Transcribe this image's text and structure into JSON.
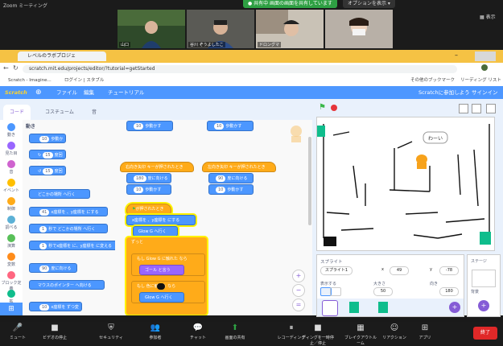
{
  "zoom": {
    "title": "Zoom ミーティング",
    "share_banner": "● 共有中  画面の画面を共有しています",
    "options_button": "オプションを表示 ▾",
    "view_label": "表示",
    "participants": [
      {
        "name": "山口"
      },
      {
        "name": "谷川 ぞうよしたこ"
      },
      {
        "name": "ドロングマ"
      },
      {
        "name": ""
      }
    ],
    "toolbar": [
      {
        "label": "ミュート",
        "icon": "microphone-icon",
        "glyph": "🎤"
      },
      {
        "label": "ビデオの停止",
        "icon": "video-camera-icon",
        "glyph": "■"
      },
      {
        "label": "セキュリティ",
        "icon": "shield-icon",
        "glyph": "⛨"
      },
      {
        "label": "参加者",
        "icon": "participants-icon",
        "glyph": "👥"
      },
      {
        "label": "チャット",
        "icon": "chat-icon",
        "glyph": "💬"
      },
      {
        "label": "画面の共有",
        "icon": "share-screen-icon",
        "glyph": "⬆"
      },
      {
        "label": "レコーディング",
        "icon": "pause-icon",
        "glyph": "⏸"
      },
      {
        "label": "ディングを一時停止／停止",
        "icon": "stop-icon",
        "glyph": "■"
      },
      {
        "label": "ブレイクアウトルーム",
        "icon": "breakout-rooms-icon",
        "glyph": "▦"
      },
      {
        "label": "リアクション",
        "icon": "reaction-icon",
        "glyph": "☺"
      },
      {
        "label": "アプリ",
        "icon": "apps-icon",
        "glyph": "⊞"
      }
    ],
    "end_button": "終了"
  },
  "browser": {
    "tab_title": "レベルのラボプロジェ",
    "url": "scratch.mit.edu/projects/editor/?tutorial=getStarted",
    "bookmarks": [
      "Scratch - Imagine...",
      "ログイン | スタブル"
    ],
    "bookmark_right": [
      "その他のブックマーク",
      "リーディング リスト"
    ]
  },
  "scratch_menu": {
    "logo": "Scratch",
    "file": "ファイル",
    "edit": "編集",
    "tutorials": "チュートリアル",
    "share_link": "Scratchに参加しよう",
    "signin": "サインイン"
  },
  "editor_tabs": [
    "コード",
    "コスチューム",
    "音"
  ],
  "categories": [
    {
      "label": "動き",
      "color": "#4c97ff"
    },
    {
      "label": "見た目",
      "color": "#9966ff"
    },
    {
      "label": "音",
      "color": "#cf63cf"
    },
    {
      "label": "イベント",
      "color": "#ffbf00"
    },
    {
      "label": "制御",
      "color": "#ffab19"
    },
    {
      "label": "調べる",
      "color": "#5cb1d6"
    },
    {
      "label": "演算",
      "color": "#59c059"
    },
    {
      "label": "変数",
      "color": "#ff8c1a"
    },
    {
      "label": "ブロック定義",
      "color": "#ff6680"
    },
    {
      "label": "拡",
      "color": "#0fbd8c"
    }
  ],
  "palette": {
    "heading": "動き",
    "blocks": [
      {
        "text": "歩動かす",
        "value": "10"
      },
      {
        "text": "度回す",
        "value": "15"
      },
      {
        "text": "度回す",
        "value": "15"
      },
      {
        "text": "どこかの場所 へ行く",
        "value": ""
      },
      {
        "text": "x座標を  、y座標を  にする",
        "value": "41"
      },
      {
        "text": "秒で どこかの場所 へ行く",
        "value": "1"
      },
      {
        "text": "秒でx座標を  に、y座標を  に変える",
        "value": "1"
      },
      {
        "text": "度に向ける",
        "value": "90"
      },
      {
        "text": "マウスのポインター へ向ける",
        "value": ""
      },
      {
        "text": "x座標を  ずつ変える",
        "value": "10"
      }
    ]
  },
  "script": {
    "top_left": {
      "text": "歩動かす",
      "value": "10"
    },
    "top_right": {
      "text": "歩動かす",
      "value": "10"
    },
    "event1": "右向き矢印 キーが押されたとき",
    "event1_turn": {
      "text": "度に向ける",
      "value": "180"
    },
    "event1_move": {
      "text": "歩動かす",
      "value": "10"
    },
    "event2": "左向き矢印 キーが押されたとき",
    "event2_turn": {
      "text": "度に向ける",
      "value": "90"
    },
    "event2_move": {
      "text": "歩動かす",
      "value": "10"
    },
    "flag_hat": "が押されたとき",
    "goto_xy": "x座標を  、y座標を  にする",
    "forever": "ずっと",
    "if1": "もし Glow G に触れた なら",
    "say": "ゴール と言う",
    "if2": "もし  色に触れた なら",
    "goto_sprite": "Glow G へ行く",
    "goto_sprite2": "Glow G へ行く"
  },
  "stage": {
    "speech": "わーい",
    "sprite_panel": {
      "label": "スプライト",
      "name": "スプライト1",
      "x_label": "x",
      "x": "49",
      "y_label": "y",
      "y": "-78",
      "show_label": "表示する",
      "size_label": "大きさ",
      "size": "50",
      "direction_label": "向き",
      "direction": "180"
    },
    "stage_label": "ステージ",
    "backdrops_label": "背景"
  }
}
